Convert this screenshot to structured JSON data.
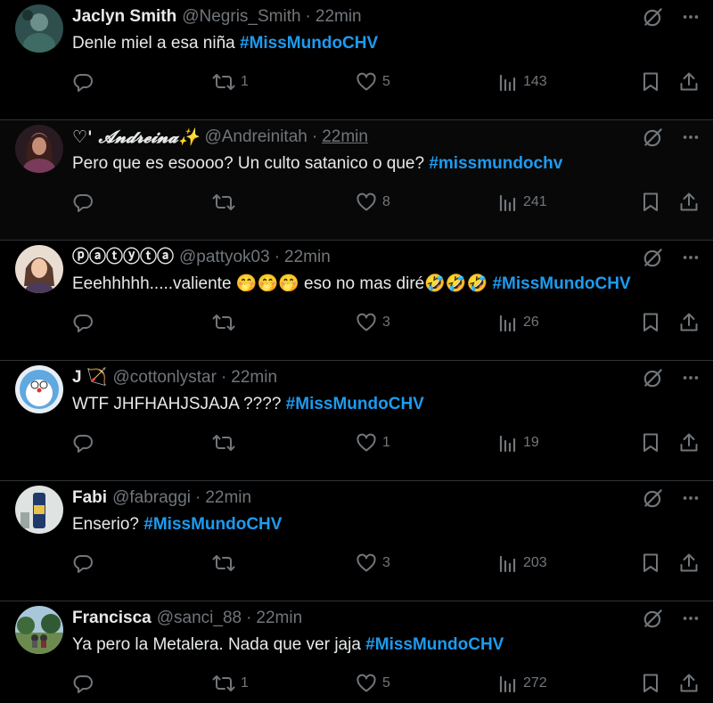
{
  "tweets": [
    {
      "name": "Jaclyn Smith",
      "handle": "@Negris_Smith",
      "time": "22min",
      "text": "Denle miel a esa niña ",
      "hashtag": "#MissMundoCHV",
      "retweets": "1",
      "likes": "5",
      "views": "143"
    },
    {
      "name": "♡' 𝓐𝓷𝓭𝓻𝓮𝓲𝓷𝓪✨",
      "handle": "@Andreinitah",
      "time": "22min",
      "text": "Pero que es esoooo? Un culto satanico o que? ",
      "hashtag": "#missmundochv",
      "retweets": "",
      "likes": "8",
      "views": "241"
    },
    {
      "name": "ⓟⓐⓣⓨⓣⓐ",
      "handle": "@pattyok03",
      "time": "22min",
      "text": "Eeehhhhh.....valiente 🤭🤭🤭 eso no mas diré🤣🤣🤣 ",
      "hashtag": "#MissMundoCHV",
      "retweets": "",
      "likes": "3",
      "views": "26"
    },
    {
      "name": "J 🏹",
      "handle": "@cottonlystar",
      "time": "22min",
      "text": "WTF JHFHAHJSJAJA ???? ",
      "hashtag": "#MissMundoCHV",
      "retweets": "",
      "likes": "1",
      "views": "19"
    },
    {
      "name": "Fabi",
      "handle": "@fabraggi",
      "time": "22min",
      "text": "Enserio? ",
      "hashtag": "#MissMundoCHV",
      "retweets": "",
      "likes": "3",
      "views": "203"
    },
    {
      "name": "Francisca",
      "handle": "@sanci_88",
      "time": "22min",
      "text": "Ya pero la Metalera. Nada que ver jaja ",
      "hashtag": "#MissMundoCHV",
      "retweets": "1",
      "likes": "5",
      "views": "272"
    }
  ],
  "icons": {
    "mute": "grok-icon",
    "more": "more-icon",
    "reply": "reply-icon",
    "retweet": "retweet-icon",
    "like": "like-icon",
    "views": "views-icon",
    "bookmark": "bookmark-icon",
    "share": "share-icon"
  },
  "colors": {
    "background": "#000000",
    "text": "#e7e9ea",
    "muted": "#71767b",
    "hashtag": "#1d9bf0",
    "divider": "#2f3336"
  }
}
